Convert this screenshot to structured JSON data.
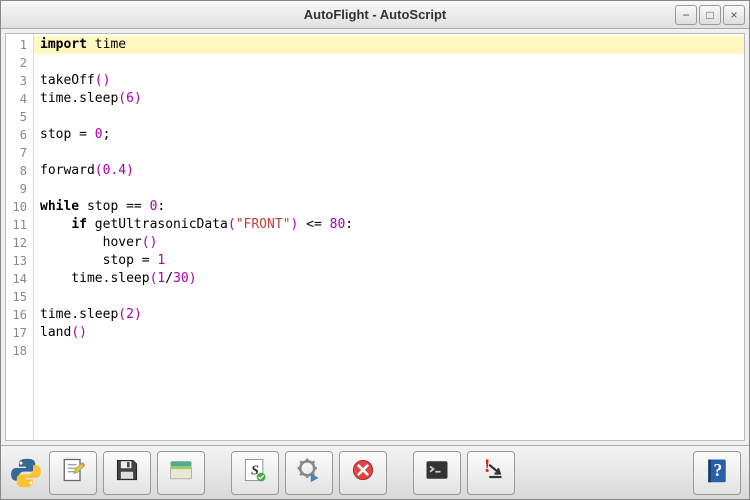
{
  "window": {
    "title": "AutoFlight - AutoScript"
  },
  "titlebar_buttons": {
    "minimize": "−",
    "maximize": "□",
    "close": "×"
  },
  "editor": {
    "highlighted_line": 1,
    "line_count": 18,
    "lines": [
      [
        [
          "keyword",
          "import"
        ],
        [
          "plain",
          " time"
        ]
      ],
      [],
      [
        [
          "func",
          "takeOff"
        ],
        [
          "paren",
          "()"
        ]
      ],
      [
        [
          "plain",
          "time.sleep"
        ],
        [
          "paren",
          "("
        ],
        [
          "num",
          "6"
        ],
        [
          "paren",
          ")"
        ]
      ],
      [],
      [
        [
          "plain",
          "stop "
        ],
        [
          "op",
          "="
        ],
        [
          "plain",
          " "
        ],
        [
          "num",
          "0"
        ],
        [
          "plain",
          ";"
        ]
      ],
      [],
      [
        [
          "func",
          "forward"
        ],
        [
          "paren",
          "("
        ],
        [
          "num",
          "0.4"
        ],
        [
          "paren",
          ")"
        ]
      ],
      [],
      [
        [
          "keyword",
          "while"
        ],
        [
          "plain",
          " stop "
        ],
        [
          "op",
          "=="
        ],
        [
          "plain",
          " "
        ],
        [
          "num",
          "0"
        ],
        [
          "plain",
          ":"
        ]
      ],
      [
        [
          "plain",
          "    "
        ],
        [
          "keyword",
          "if"
        ],
        [
          "plain",
          " getUltrasonicData"
        ],
        [
          "paren",
          "("
        ],
        [
          "str",
          "\"FRONT\""
        ],
        [
          "paren",
          ")"
        ],
        [
          "plain",
          " "
        ],
        [
          "op",
          "<="
        ],
        [
          "plain",
          " "
        ],
        [
          "num",
          "80"
        ],
        [
          "plain",
          ":"
        ]
      ],
      [
        [
          "plain",
          "        hover"
        ],
        [
          "paren",
          "()"
        ]
      ],
      [
        [
          "plain",
          "        stop "
        ],
        [
          "op",
          "="
        ],
        [
          "plain",
          " "
        ],
        [
          "num",
          "1"
        ]
      ],
      [
        [
          "plain",
          "    time.sleep"
        ],
        [
          "paren",
          "("
        ],
        [
          "num",
          "1"
        ],
        [
          "op",
          "/"
        ],
        [
          "num",
          "30"
        ],
        [
          "paren",
          ")"
        ]
      ],
      [],
      [
        [
          "plain",
          "time.sleep"
        ],
        [
          "paren",
          "("
        ],
        [
          "num",
          "2"
        ],
        [
          "paren",
          ")"
        ]
      ],
      [
        [
          "func",
          "land"
        ],
        [
          "paren",
          "()"
        ]
      ],
      []
    ]
  },
  "toolbar": {
    "items": [
      {
        "name": "python-icon",
        "type": "python",
        "gap_after": false
      },
      {
        "name": "edit-script-button",
        "type": "pencil",
        "gap_after": false
      },
      {
        "name": "save-button",
        "type": "save",
        "gap_after": false
      },
      {
        "name": "open-button",
        "type": "open",
        "gap_after": true
      },
      {
        "name": "syntax-check-button",
        "type": "script-s",
        "gap_after": false
      },
      {
        "name": "run-button",
        "type": "run-gear",
        "gap_after": false
      },
      {
        "name": "stop-button",
        "type": "stop-x",
        "gap_after": true
      },
      {
        "name": "console-button",
        "type": "console",
        "gap_after": false
      },
      {
        "name": "land-button",
        "type": "land",
        "gap_after": false
      },
      {
        "name": "help-button",
        "type": "help",
        "gap_after": false,
        "spacer_before": true
      }
    ]
  }
}
